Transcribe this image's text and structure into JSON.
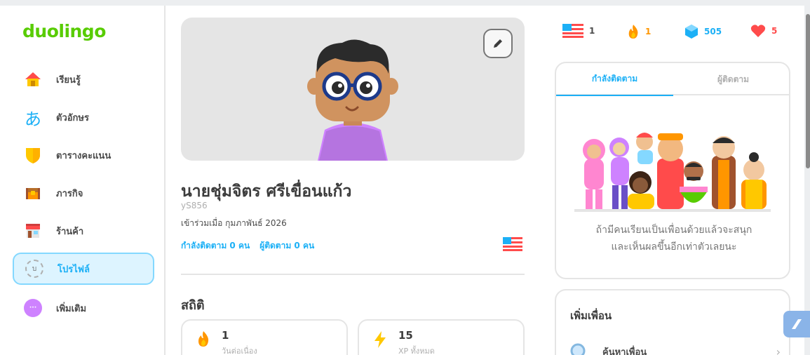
{
  "app": {
    "logo": "duolingo",
    "accent": "#58cc02",
    "link_color": "#1cb0f6"
  },
  "sidebar": {
    "items": [
      {
        "label": "เรียนรู้",
        "icon": "home-icon",
        "active": false
      },
      {
        "label": "ตัวอักษร",
        "icon": "hiragana-icon",
        "active": false
      },
      {
        "label": "ตารางคะแนน",
        "icon": "shield-icon",
        "active": false
      },
      {
        "label": "ภารกิจ",
        "icon": "treasure-chest-icon",
        "active": false
      },
      {
        "label": "ร้านค้า",
        "icon": "shop-icon",
        "active": false
      },
      {
        "label": "โปรไฟล์",
        "icon": "profile-icon",
        "active": true
      },
      {
        "label": "เพิ่มเติม",
        "icon": "more-icon",
        "active": false
      }
    ],
    "hiragana_glyph": "あ",
    "profile_glyph": "บ",
    "more_glyph": "···"
  },
  "profile": {
    "name": "นายชุ่มจิตร ศรีเขื่อนแก้ว",
    "username": "yS856",
    "joined": "เข้าร่วมเมื่อ กุมภาพันธ์ 2026",
    "following_link": "กำลังติดตาม 0 คน",
    "followers_link": "ผู้ติดตาม 0 คน"
  },
  "stats": {
    "title": "สถิติ",
    "items": [
      {
        "value": "1",
        "label": "วันต่อเนื่อง",
        "icon": "flame-icon"
      },
      {
        "value": "15",
        "label": "XP ทั้งหมด",
        "icon": "lightning-icon"
      }
    ]
  },
  "topbar": {
    "courses": "1",
    "streak": "1",
    "gems": "505",
    "hearts": "5"
  },
  "follow_panel": {
    "tabs": [
      {
        "label": "กำลังติดตาม",
        "active": true
      },
      {
        "label": "ผู้ติดตาม",
        "active": false
      }
    ],
    "message_line1": "ถ้ามีคนเรียนเป็นเพื่อนด้วยแล้วจะสนุก",
    "message_line2": "และเห็นผลขึ้นอีกเท่าตัวเลยนะ"
  },
  "add_friends": {
    "title": "เพิ่มเพื่อน",
    "search_label": "ค้นหาเพื่อน",
    "chevron": "›"
  }
}
